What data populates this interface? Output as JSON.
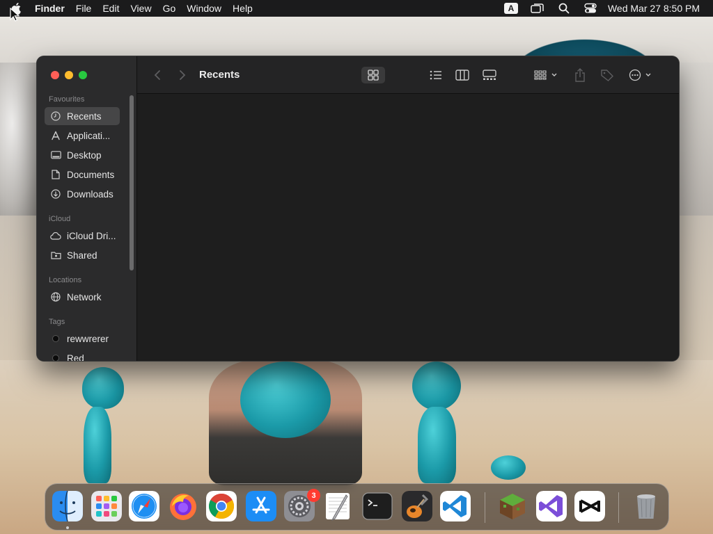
{
  "menubar": {
    "app_name": "Finder",
    "menus": [
      "File",
      "Edit",
      "View",
      "Go",
      "Window",
      "Help"
    ],
    "input_source": "A",
    "clock": "Wed Mar 27  8:50 PM"
  },
  "window": {
    "title": "Recents",
    "sidebar": {
      "favourites_header": "Favourites",
      "favourites": [
        {
          "label": "Recents",
          "icon": "clock-icon",
          "selected": true
        },
        {
          "label": "Applicati...",
          "icon": "applications-icon"
        },
        {
          "label": "Desktop",
          "icon": "desktop-icon"
        },
        {
          "label": "Documents",
          "icon": "document-icon"
        },
        {
          "label": "Downloads",
          "icon": "download-icon"
        }
      ],
      "icloud_header": "iCloud",
      "icloud": [
        {
          "label": "iCloud Dri...",
          "icon": "cloud-icon"
        },
        {
          "label": "Shared",
          "icon": "shared-folder-icon"
        }
      ],
      "locations_header": "Locations",
      "locations": [
        {
          "label": "Network",
          "icon": "globe-icon"
        }
      ],
      "tags_header": "Tags",
      "tags": [
        {
          "label": "rewwrerer",
          "color": "#0b0b0b"
        },
        {
          "label": "Red",
          "color": "#0b0b0b"
        }
      ]
    },
    "toolbar": {
      "view_modes": [
        "icon-view",
        "list-view",
        "column-view",
        "gallery-view"
      ],
      "active_view": "icon-view"
    }
  },
  "dock": {
    "apps": [
      "Finder",
      "Launchpad",
      "Safari",
      "Firefox",
      "Chrome",
      "App Store",
      "System Settings",
      "TextEdit",
      "Terminal",
      "GarageBand",
      "Visual Studio Code",
      "Minecraft",
      "Visual Studio",
      "CapCut",
      "Trash"
    ],
    "system_settings_badge": "3"
  }
}
